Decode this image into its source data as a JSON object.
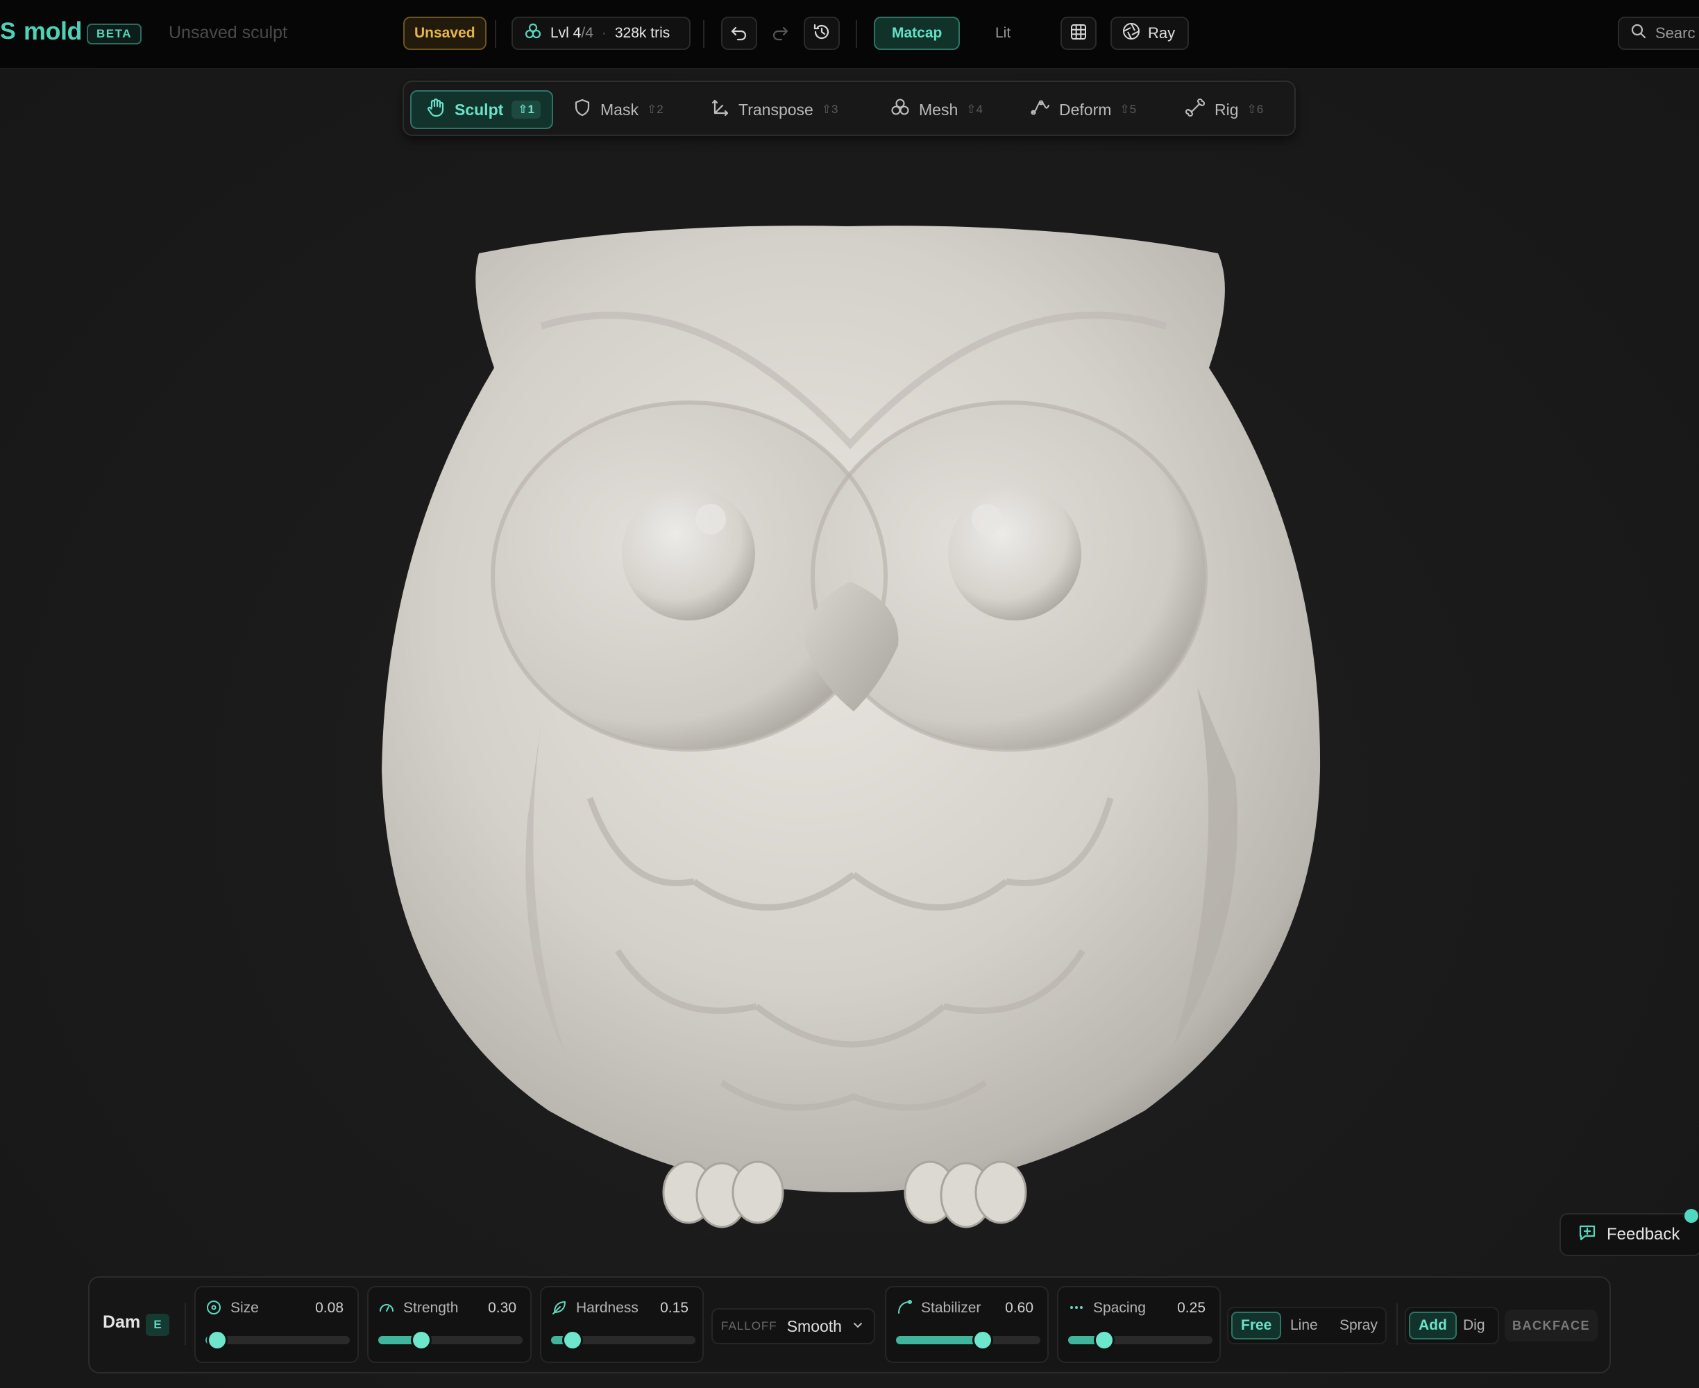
{
  "app": {
    "brand_edge": "S",
    "brand": "mold",
    "badge": "BETA",
    "document_title": "Unsaved sculpt"
  },
  "toolbar": {
    "status": "Unsaved",
    "level_label": "Lvl 4",
    "level_total": "/4",
    "tris": "328k tris",
    "undo_icon": "undo-icon",
    "redo_icon": "redo-icon",
    "history_icon": "history-icon",
    "shading_matcap": "Matcap",
    "shading_lit": "Lit",
    "grid_icon": "grid-icon",
    "ray_label": "Ray",
    "search_label": "Searc"
  },
  "modes": [
    {
      "label": "Sculpt",
      "key": "⇧1",
      "icon": "hand-icon",
      "active": true
    },
    {
      "label": "Mask",
      "key": "⇧2",
      "icon": "shield-icon",
      "active": false
    },
    {
      "label": "Transpose",
      "key": "⇧3",
      "icon": "transpose-icon",
      "active": false
    },
    {
      "label": "Mesh",
      "key": "⇧4",
      "icon": "mesh-icon",
      "active": false
    },
    {
      "label": "Deform",
      "key": "⇧5",
      "icon": "deform-icon",
      "active": false
    },
    {
      "label": "Rig",
      "key": "⇧6",
      "icon": "bone-icon",
      "active": false
    }
  ],
  "viewport": {
    "subject": "owl sculpt"
  },
  "feedback": {
    "label": "Feedback"
  },
  "brush": {
    "name": "Dam",
    "shortcut": "E",
    "sliders": [
      {
        "label": "Size",
        "value": "0.08",
        "fraction": 0.08
      },
      {
        "label": "Strength",
        "value": "0.30",
        "fraction": 0.3
      },
      {
        "label": "Hardness",
        "value": "0.15",
        "fraction": 0.15
      },
      {
        "label": "Stabilizer",
        "value": "0.60",
        "fraction": 0.6
      },
      {
        "label": "Spacing",
        "value": "0.25",
        "fraction": 0.25
      }
    ],
    "falloff_label": "FALLOFF",
    "falloff_value": "Smooth",
    "stroke_modes": [
      "Free",
      "Line",
      "Spray"
    ],
    "stroke_active": "Free",
    "direction_modes": [
      "Add",
      "Dig"
    ],
    "direction_active": "Add",
    "backface": "BACKFACE"
  },
  "colors": {
    "accent": "#4fd1b8",
    "warning": "#e7b64a",
    "background": "#1a1a1a"
  }
}
